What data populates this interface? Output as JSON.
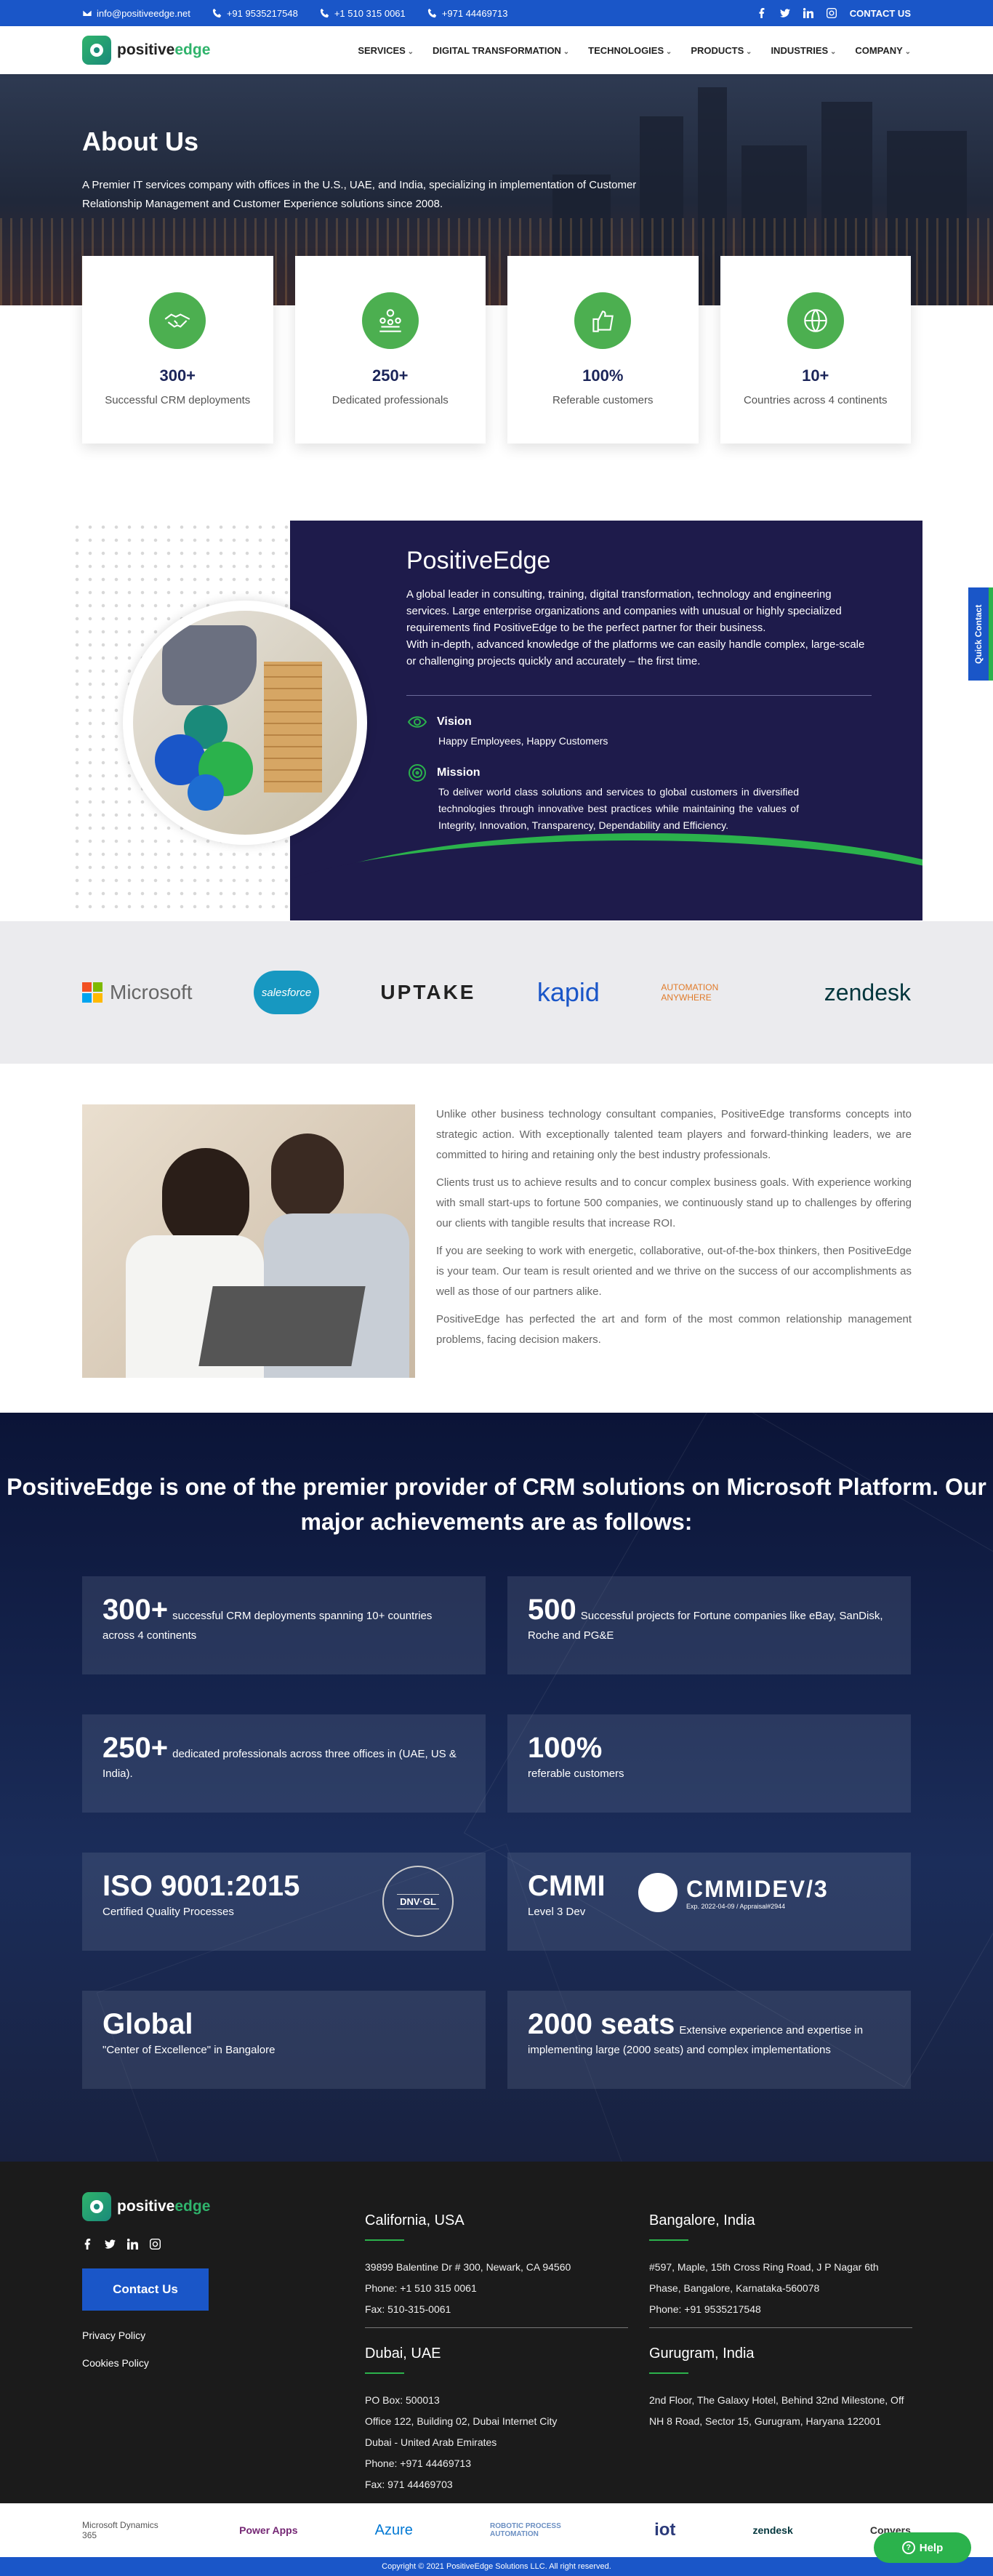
{
  "topbar": {
    "email": "info@positiveedge.net",
    "phone1": "+91 9535217548",
    "phone2": "+1 510 315 0061",
    "phone3": "+971 44469713",
    "contact": "CONTACT US"
  },
  "brand": {
    "name_a": "positive",
    "name_b": "edge",
    "accent": "#2fb36b",
    "primary": "#1a56c8"
  },
  "nav": [
    "SERVICES",
    "DIGITAL TRANSFORMATION",
    "TECHNOLOGIES",
    "PRODUCTS",
    "INDUSTRIES",
    "COMPANY"
  ],
  "hero": {
    "title": "About Us",
    "text": "A Premier IT services company with offices in the U.S., UAE, and India, specializing in implementation of Customer Relationship Management and Customer Experience solutions since 2008."
  },
  "stats": [
    {
      "num": "300+",
      "label": "Successful CRM deployments",
      "icon": "handshake-icon"
    },
    {
      "num": "250+",
      "label": "Dedicated professionals",
      "icon": "team-icon"
    },
    {
      "num": "100%",
      "label": "Referable customers",
      "icon": "thumbs-up-icon"
    },
    {
      "num": "10+",
      "label": "Countries across 4 continents",
      "icon": "globe-icon"
    }
  ],
  "about": {
    "title": "PositiveEdge",
    "desc": "A global leader in consulting, training, digital transformation, technology and engineering services. Large enterprise organizations and companies with unusual or highly specialized requirements find PositiveEdge to be the perfect partner for their business.",
    "desc2": "With in-depth, advanced knowledge of the platforms we can easily handle complex, large-scale or challenging projects quickly and accurately – the first time.",
    "vision_title": "Vision",
    "vision_text": "Happy Employees, Happy Customers",
    "mission_title": "Mission",
    "mission_text": "To deliver world class solutions and services to global customers in diversified technologies through innovative best practices while maintaining the values of Integrity, Innovation, Transparency, Dependability and Efficiency."
  },
  "logos": [
    "Microsoft",
    "salesforce",
    "UPTAKE",
    "kapid",
    "AUTOMATION ANYWHERE",
    "zendesk"
  ],
  "intro": [
    "Unlike other business technology consultant companies, PositiveEdge transforms concepts into strategic action. With exceptionally talented team players and forward-thinking leaders, we are committed to hiring and retaining only the best industry professionals.",
    "Clients trust us to achieve results and to concur complex business goals. With experience working with small start-ups to fortune 500 companies, we continuously stand up to challenges by offering our clients with tangible results that increase ROI.",
    "If you are seeking to work with energetic, collaborative, out-of-the-box thinkers, then PositiveEdge is your team. Our team is result oriented and we thrive on the success of our accomplishments as well as those of our partners alike.",
    "PositiveEdge has perfected the art and form of the most common relationship management problems, facing decision makers."
  ],
  "achievements": {
    "title": "PositiveEdge is one of the premier provider of CRM solutions on Microsoft Platform. Our major achievements are as follows:",
    "items": [
      {
        "big": "300+",
        "text": "successful CRM deployments spanning 10+ countries across 4 continents"
      },
      {
        "big": "500",
        "text": "Successful projects for Fortune companies like eBay, SanDisk, Roche and PG&E"
      },
      {
        "big": "250+",
        "text": "dedicated professionals across three offices in (UAE, US & India)."
      },
      {
        "big": "100%",
        "text": "",
        "sub": "referable customers"
      },
      {
        "big": "ISO 9001:2015",
        "text": "",
        "sub": "Certified Quality Processes",
        "badge": "DNV·GL"
      },
      {
        "big": "CMMI",
        "text": "",
        "sub": "Level 3 Dev",
        "badge": "CMMIDEV/3",
        "badge_sub": "Exp. 2022-04-09 / Appraisal#2944"
      },
      {
        "big": "Global",
        "text": "",
        "sub": "\"Center of Excellence\" in Bangalore"
      },
      {
        "big": "2000 seats",
        "text": "Extensive experience and expertise in implementing large (2000 seats) and complex implementations"
      }
    ]
  },
  "footer": {
    "contact_btn": "Contact Us",
    "privacy": "Privacy Policy",
    "cookies": "Cookies Policy",
    "offices": [
      {
        "title": "California, USA",
        "lines": [
          "39899 Balentine Dr # 300, Newark, CA 94560",
          "Phone: +1 510 315 0061",
          "Fax: 510-315-0061"
        ]
      },
      {
        "title": "Bangalore, India",
        "lines": [
          "#597, Maple, 15th Cross Ring Road, J P Nagar 6th Phase, Bangalore, Karnataka-560078",
          "Phone: +91 9535217548"
        ]
      },
      {
        "title": "Dubai, UAE",
        "lines": [
          "PO Box: 500013",
          "Office 122, Building 02, Dubai Internet City",
          "Dubai - United Arab Emirates",
          "Phone: +971 44469713",
          "Fax: 971 44469703"
        ]
      },
      {
        "title": "Gurugram, India",
        "lines": [
          "2nd Floor, The Galaxy Hotel, Behind 32nd Milestone, Off NH 8 Road, Sector 15, Gurugram, Haryana 122001"
        ]
      }
    ]
  },
  "partners": [
    "Microsoft Dynamics 365",
    "Power Apps",
    "Azure",
    "ROBOTIC PROCESS AUTOMATION",
    "iot",
    "zendesk",
    "Convers"
  ],
  "copyright": "Copyright © 2021 PositiveEdge Solutions LLC. All right reserved.",
  "quick_contact": "Quick Contact",
  "help": "Help"
}
